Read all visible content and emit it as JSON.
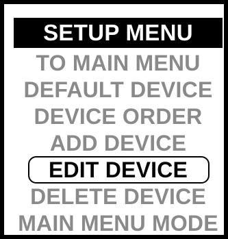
{
  "menu": {
    "title": "SETUP MENU",
    "items": [
      {
        "label": "TO MAIN MENU"
      },
      {
        "label": "DEFAULT DEVICE"
      },
      {
        "label": "DEVICE ORDER"
      },
      {
        "label": "ADD DEVICE"
      },
      {
        "label": "EDIT DEVICE",
        "selected": true
      },
      {
        "label": "DELETE DEVICE"
      },
      {
        "label": "MAIN MENU MODE"
      }
    ]
  },
  "colors": {
    "frame": "#000000",
    "header_bg": "#000000",
    "header_text": "#ffffff",
    "item_text": "#8a8a8a",
    "selected_text": "#000000",
    "background": "#ffffff"
  }
}
